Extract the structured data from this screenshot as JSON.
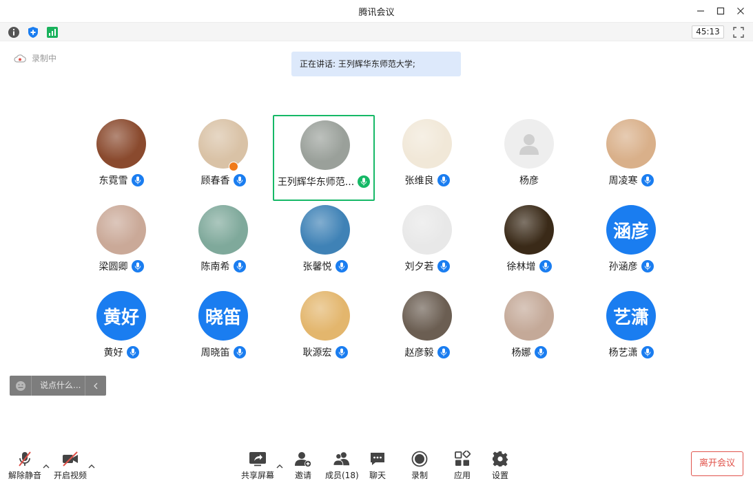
{
  "window": {
    "title": "腾讯会议"
  },
  "status": {
    "timer": "45:13"
  },
  "recording": {
    "label": "录制中"
  },
  "speaking": {
    "text": "正在讲话: 王列辉华东师范大学;"
  },
  "participants": [
    {
      "name": "东霓雪",
      "avatar": "photo",
      "color": "#8a4a2e"
    },
    {
      "name": "顾春香",
      "avatar": "photo",
      "color": "#d9c2a6",
      "host": true
    },
    {
      "name": "王列辉华东师范...",
      "avatar": "photo",
      "color": "#9aa09a",
      "active": true
    },
    {
      "name": "张维良",
      "avatar": "photo",
      "color": "#f1e8d8"
    },
    {
      "name": "杨彦",
      "avatar": "default",
      "color": "#eeeeee",
      "muted_hidden": true
    },
    {
      "name": "周凌寒",
      "avatar": "photo",
      "color": "#d9b08a"
    },
    {
      "name": "梁圆卿",
      "avatar": "photo",
      "color": "#caa998"
    },
    {
      "name": "陈南希",
      "avatar": "photo",
      "color": "#7fa99b"
    },
    {
      "name": "张馨悦",
      "avatar": "photo",
      "color": "#3f82b6"
    },
    {
      "name": "刘夕若",
      "avatar": "photo",
      "color": "#e8e8e8"
    },
    {
      "name": "徐林增",
      "avatar": "photo",
      "color": "#3a2a18"
    },
    {
      "name": "孙涵彦",
      "avatar": "text",
      "initials": "涵彦"
    },
    {
      "name": "黄好",
      "avatar": "text",
      "initials": "黄好"
    },
    {
      "name": "周晓笛",
      "avatar": "text",
      "initials": "晓笛"
    },
    {
      "name": "耿源宏",
      "avatar": "photo",
      "color": "#e3b66d"
    },
    {
      "name": "赵彦毅",
      "avatar": "photo",
      "color": "#6b5e52"
    },
    {
      "name": "杨娜",
      "avatar": "photo",
      "color": "#c4a998"
    },
    {
      "name": "杨艺潇",
      "avatar": "text",
      "initials": "艺潇"
    }
  ],
  "chat": {
    "placeholder": "说点什么..."
  },
  "toolbar": {
    "unmute": "解除静音",
    "video": "开启视频",
    "share": "共享屏幕",
    "invite": "邀请",
    "members": "成员(18)",
    "chat": "聊天",
    "record": "录制",
    "apps": "应用",
    "settings": "设置",
    "leave": "离开会议"
  },
  "colors": {
    "accent": "#1a7df0",
    "active_border": "#15b866",
    "leave": "#e0524a"
  }
}
